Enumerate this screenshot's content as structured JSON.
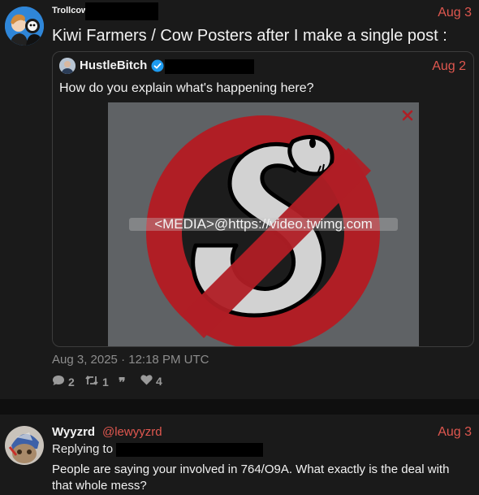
{
  "post1": {
    "author": "Trollcow",
    "date": "Aug 3",
    "text": "Kiwi Farmers / Cow Posters after I make a single post :",
    "quote": {
      "author": "HustleBitch",
      "date": "Aug 2",
      "text": "How do you explain what's happening here?",
      "media_url": "<MEDIA>@https://video.twimg.com"
    },
    "timestamp": "Aug 3, 2025 · 12:18 PM UTC",
    "stats": {
      "replies": "2",
      "retweets": "1",
      "quotes": "",
      "likes": "4"
    }
  },
  "post2": {
    "author": "Wyyzrd",
    "handle": "@lewyyzrd",
    "date": "Aug 3",
    "replying_label": "Replying to",
    "text_line1": "People are saying your involved in 764/O9A. What exactly is the deal with",
    "text_line2": "that whole mess?"
  },
  "colors": {
    "accent": "#e0574f",
    "verified": "#1d9bf0",
    "background": "#1a1a1a"
  },
  "icons": [
    "reply-icon",
    "retweet-icon",
    "quote-icon",
    "heart-icon",
    "verified-icon",
    "close-icon"
  ]
}
